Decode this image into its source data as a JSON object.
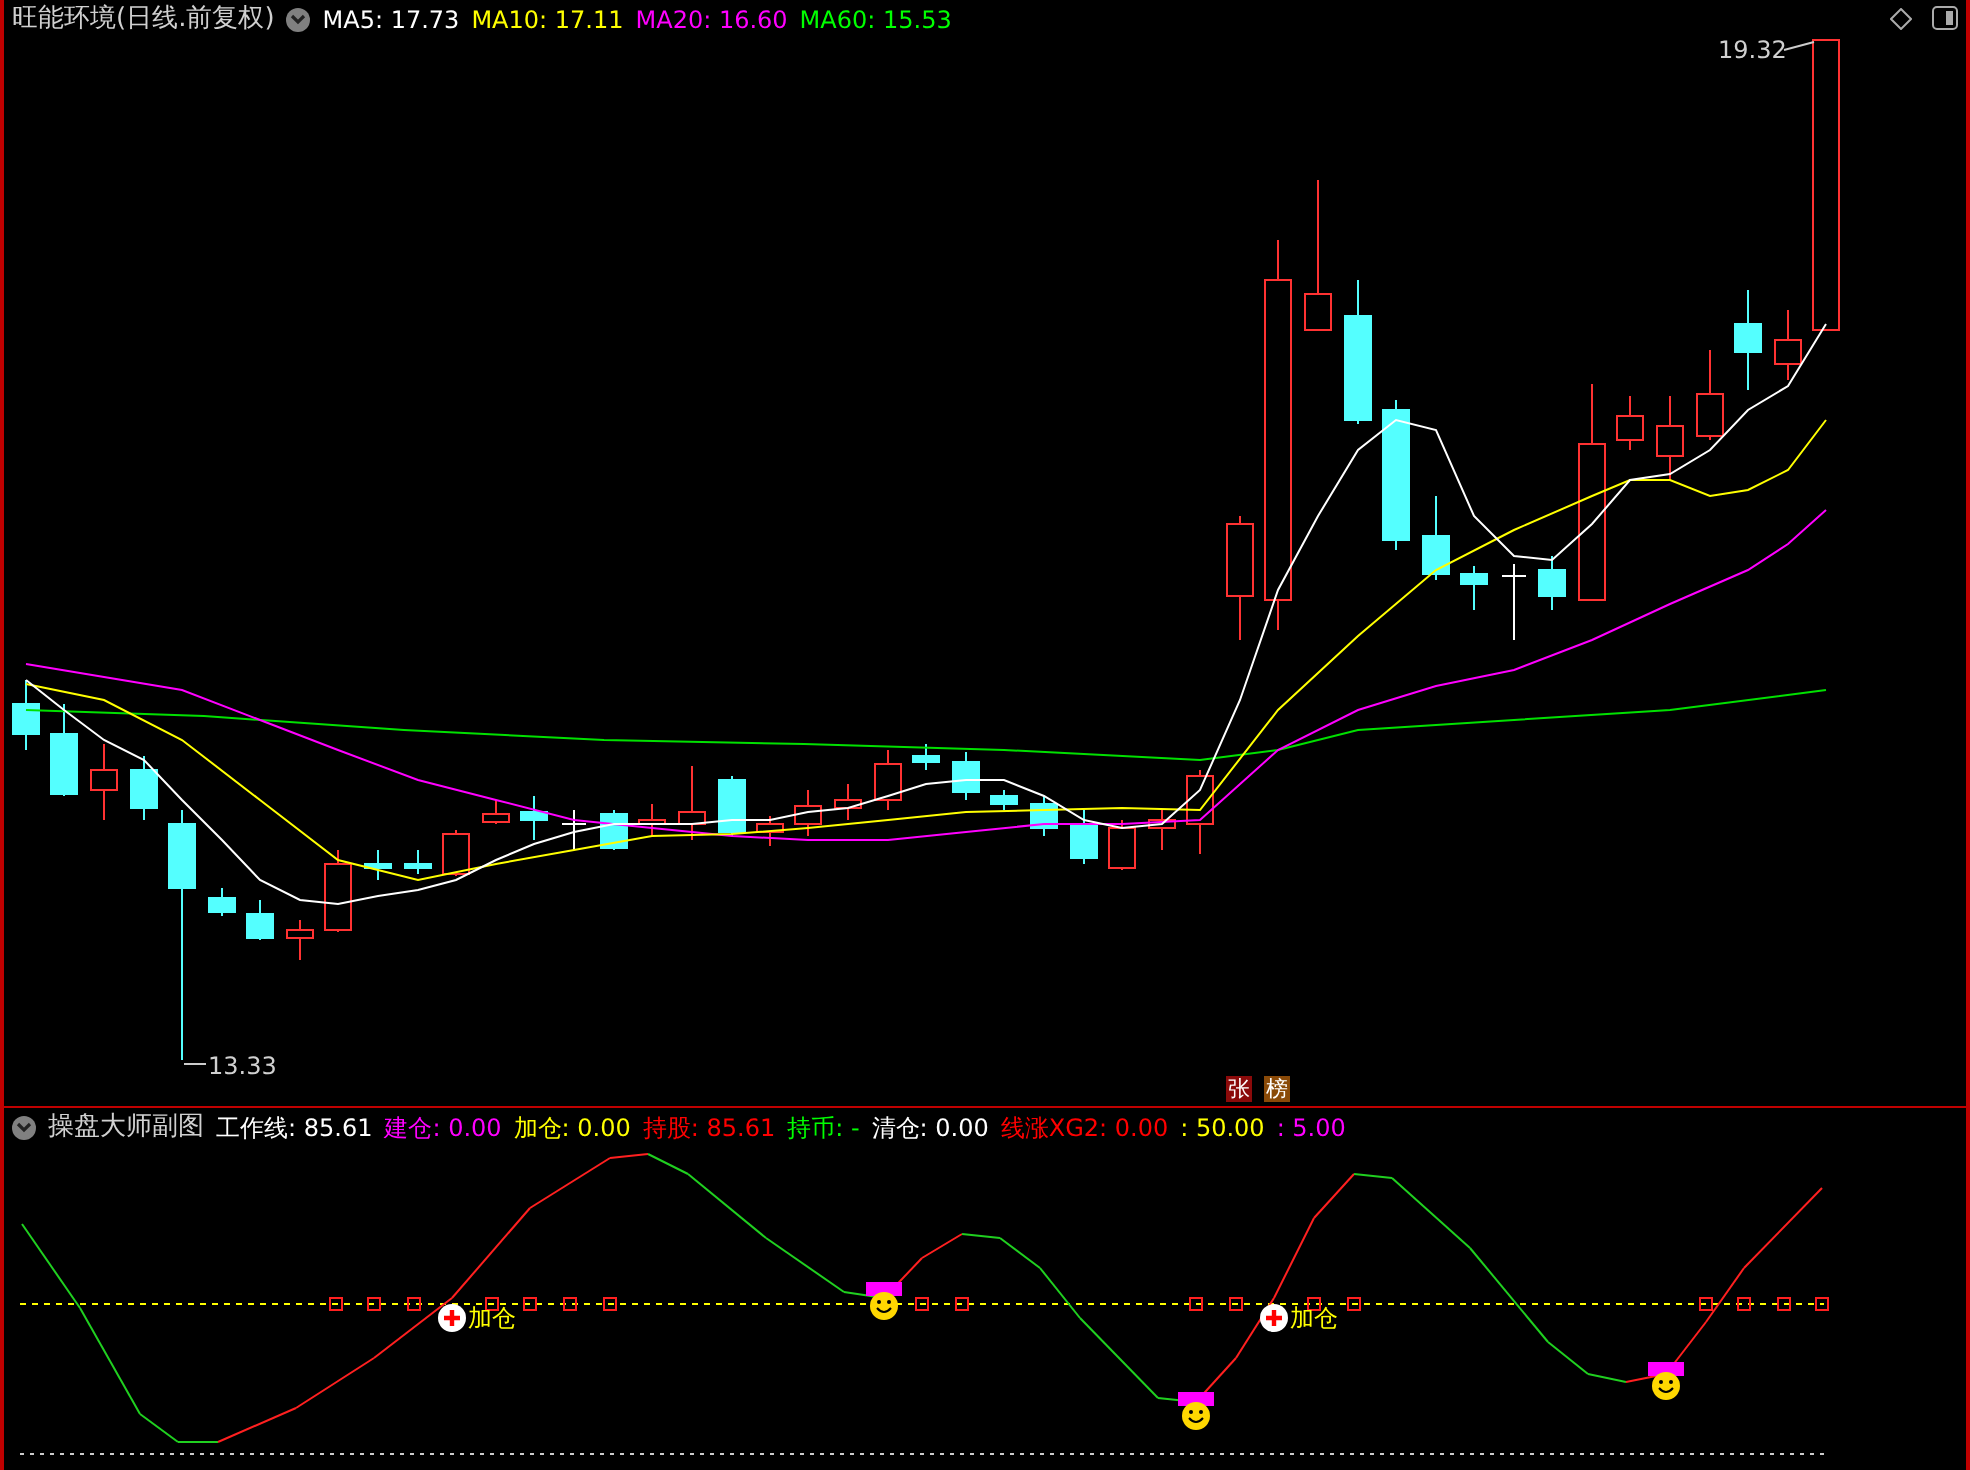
{
  "header": {
    "title": "旺能环境(日线.前复权)",
    "indicators": [
      {
        "label": "MA5: 17.73",
        "color": "#ffffff"
      },
      {
        "label": "MA10: 17.11",
        "color": "#ffff00"
      },
      {
        "label": "MA20: 16.60",
        "color": "#ff00ff"
      },
      {
        "label": "MA60: 15.53",
        "color": "#00ff00"
      }
    ]
  },
  "main_chart": {
    "high_label": "19.32",
    "low_label": "13.33",
    "badges": [
      {
        "text": "张",
        "color": "#8b0a0a"
      },
      {
        "text": "榜",
        "color": "#8a4a08"
      }
    ]
  },
  "sub_header": {
    "title": "操盘大师副图",
    "indicators": [
      {
        "label": "工作线: 85.61",
        "color": "#ffffff"
      },
      {
        "label": "建仓: 0.00",
        "color": "#ff00ff"
      },
      {
        "label": "加仓: 0.00",
        "color": "#ffff00"
      },
      {
        "label": "持股: 85.61",
        "color": "#ff0000"
      },
      {
        "label": "持币: -",
        "color": "#00ff00"
      },
      {
        "label": "清仓: 0.00",
        "color": "#ffffff"
      },
      {
        "label": "线涨XG2: 0.00",
        "color": "#ff0000"
      },
      {
        "label": ": 50.00",
        "color": "#ffff00"
      },
      {
        "label": ": 5.00",
        "color": "#ff00ff"
      }
    ]
  },
  "sub_chart": {
    "signals": [
      {
        "text": "加仓"
      },
      {
        "text": "加仓"
      }
    ]
  }
}
